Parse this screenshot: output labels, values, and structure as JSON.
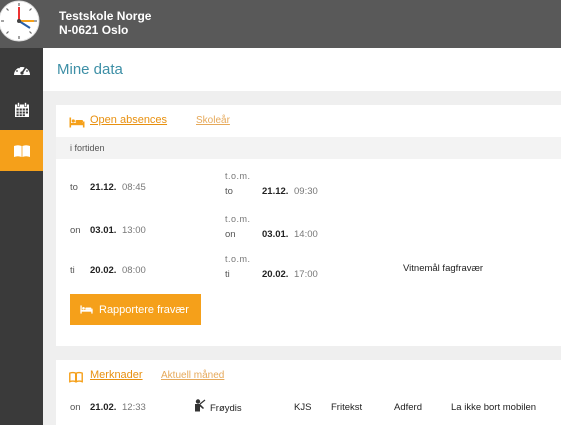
{
  "header": {
    "school_name": "Testskole Norge",
    "school_address": "N-0621 Oslo"
  },
  "sidebar": {
    "items": [
      {
        "icon": "dashboard-icon",
        "active": false
      },
      {
        "icon": "calendar-icon",
        "active": false
      },
      {
        "icon": "book-icon",
        "active": true
      }
    ]
  },
  "page": {
    "title": "Mine data"
  },
  "absences": {
    "tab_active": "Open absences",
    "tab_inactive": "Skoleår",
    "section_label": "i fortiden",
    "tom_label": "t.o.m.",
    "rows": [
      {
        "from_day": "to",
        "from_date": "21.12.",
        "from_time": "08:45",
        "to_day": "to",
        "to_date": "21.12.",
        "to_time": "09:30",
        "reason": ""
      },
      {
        "from_day": "on",
        "from_date": "03.01.",
        "from_time": "13:00",
        "to_day": "on",
        "to_date": "03.01.",
        "to_time": "14:00",
        "reason": ""
      },
      {
        "from_day": "ti",
        "from_date": "20.02.",
        "from_time": "08:00",
        "to_day": "ti",
        "to_date": "20.02.",
        "to_time": "17:00",
        "reason": "Vitnemål fagfravær"
      }
    ],
    "report_button": "Rapportere fravær"
  },
  "remarks": {
    "tab_active": "Merknader",
    "tab_inactive": "Aktuell måned",
    "row": {
      "day": "on",
      "date": "21.02.",
      "time": "12:33",
      "teacher": "Frøydis",
      "subject": "KJS",
      "type": "Fritekst",
      "category": "Adferd",
      "text": "La ikke bort mobilen"
    }
  },
  "colors": {
    "accent": "#f5a01a",
    "title": "#3d8fa6",
    "topbar": "#595959",
    "sidebar": "#3a3a3a"
  }
}
